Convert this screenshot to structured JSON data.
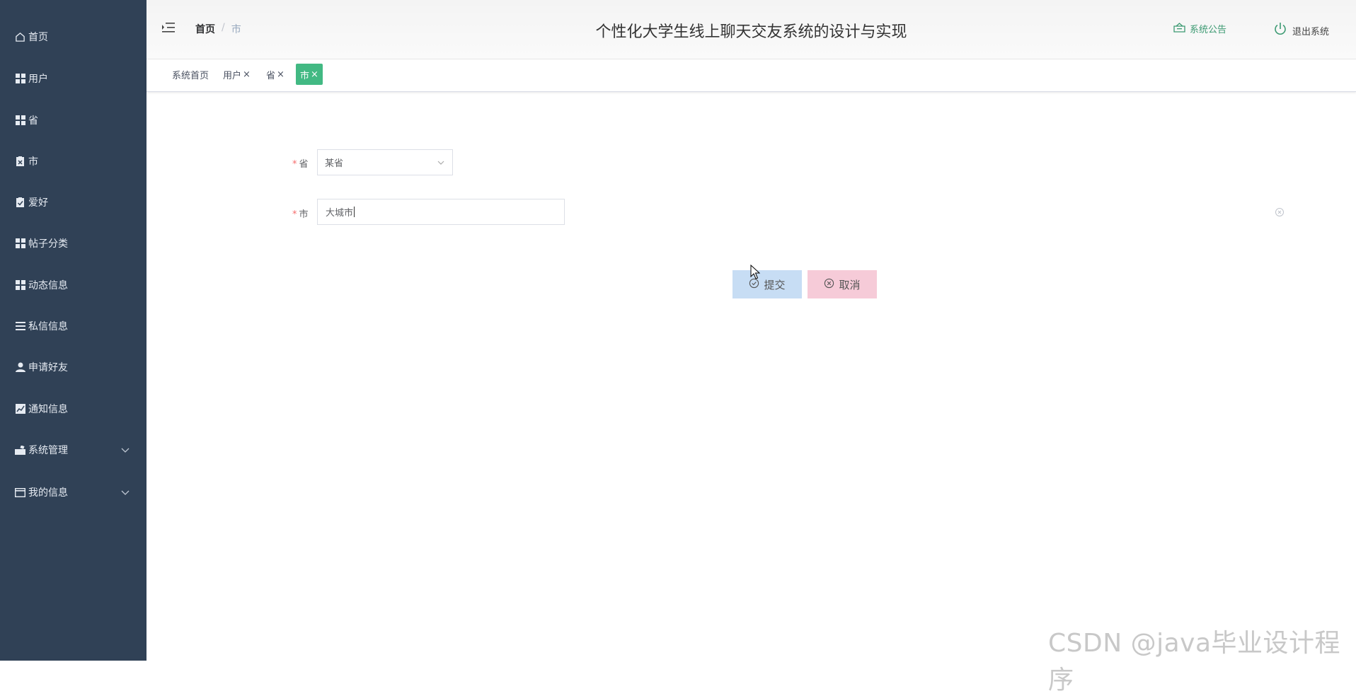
{
  "sidebar": {
    "items": [
      {
        "label": "首页",
        "icon": "home-icon"
      },
      {
        "label": "用户",
        "icon": "grid-icon"
      },
      {
        "label": "省",
        "icon": "grid-icon"
      },
      {
        "label": "市",
        "icon": "clipboard-x-icon"
      },
      {
        "label": "爱好",
        "icon": "clipboard-check-icon"
      },
      {
        "label": "帖子分类",
        "icon": "grid-icon"
      },
      {
        "label": "动态信息",
        "icon": "grid-icon"
      },
      {
        "label": "私信信息",
        "icon": "list-icon"
      },
      {
        "label": "申请好友",
        "icon": "user-icon"
      },
      {
        "label": "通知信息",
        "icon": "chart-icon"
      },
      {
        "label": "系统管理",
        "icon": "settings-icon"
      },
      {
        "label": "我的信息",
        "icon": "card-icon"
      }
    ]
  },
  "header": {
    "breadcrumb_home": "首页",
    "breadcrumb_sep": "/",
    "breadcrumb_current": "市",
    "title": "个性化大学生线上聊天交友系统的设计与实现",
    "notice_label": "系统公告",
    "logout_label": "退出系统"
  },
  "tags": [
    {
      "label": "系统首页",
      "closable": false
    },
    {
      "label": "用户",
      "closable": true
    },
    {
      "label": "省",
      "closable": true
    },
    {
      "label": "市",
      "closable": true,
      "active": true
    }
  ],
  "tag_close_glyph": "×",
  "form": {
    "province_label": "省",
    "province_value": "某省",
    "city_label": "市",
    "city_value": "大城市",
    "required_mark": "*",
    "submit_label": "提交",
    "cancel_label": "取消"
  },
  "colors": {
    "sidebar_bg": "#304156",
    "active_tag": "#42b983",
    "submit_bg": "#c7ddf4",
    "cancel_bg": "#f6cbd8",
    "required": "#f56c6c"
  },
  "watermark": "CSDN @java毕业设计程序"
}
